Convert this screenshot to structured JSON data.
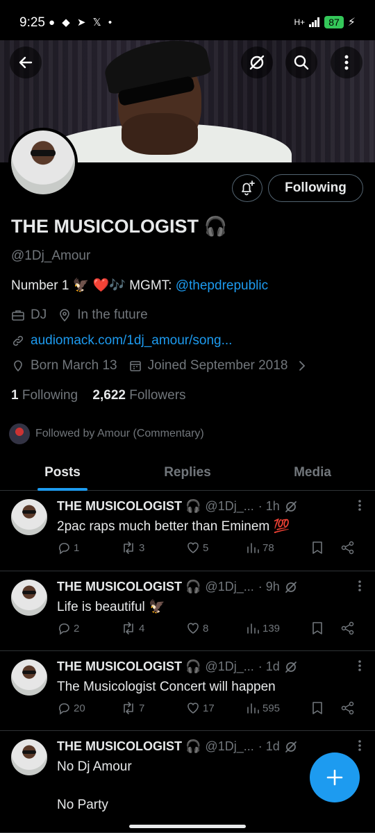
{
  "status_bar": {
    "time": "9:25",
    "notif_icons": "● ◆ ➤ 𝕏 •",
    "network": "H+",
    "battery": "87"
  },
  "header": {
    "back_icon": "back-arrow-icon",
    "icons": [
      "grok-icon",
      "search-icon",
      "more-vertical-icon"
    ]
  },
  "profile": {
    "name": "THE MUSICOLOGIST 🎧",
    "handle": "@1Dj_Amour",
    "bio_text": "Number 1 🦅 ❤️🎶 MGMT: ",
    "bio_link": "@thepdrepublic",
    "category": "DJ",
    "location": "In the future",
    "website": "audiomack.com/1dj_amour/song...",
    "born": "Born March 13",
    "joined": "Joined September 2018",
    "following_count": "1",
    "following_label": "Following",
    "followers_count": "2,622",
    "followers_label": "Followers",
    "followed_by": "Followed by Amour (Commentary)",
    "follow_button": "Following"
  },
  "tabs": [
    {
      "label": "Posts",
      "active": true
    },
    {
      "label": "Replies",
      "active": false
    },
    {
      "label": "Media",
      "active": false
    }
  ],
  "posts": [
    {
      "name": "THE MUSICOLOGIST 🎧",
      "handle": "@1Dj_...",
      "time": "· 1h",
      "text": "2pac raps much better than Eminem 💯",
      "replies": "1",
      "reposts": "3",
      "likes": "5",
      "views": "78"
    },
    {
      "name": "THE MUSICOLOGIST 🎧",
      "handle": "@1Dj_...",
      "time": "· 9h",
      "text": "Life is beautiful 🦅",
      "replies": "2",
      "reposts": "4",
      "likes": "8",
      "views": "139"
    },
    {
      "name": "THE MUSICOLOGIST 🎧",
      "handle": "@1Dj_...",
      "time": "· 1d",
      "text": "The Musicologist Concert will happen",
      "replies": "20",
      "reposts": "7",
      "likes": "17",
      "views": "595"
    },
    {
      "name": "THE MUSICOLOGIST 🎧",
      "handle": "@1Dj_...",
      "time": "· 1d",
      "text": "No Dj Amour",
      "text2": "No Party"
    }
  ],
  "colors": {
    "accent": "#1d9bf0",
    "background": "#000000",
    "muted": "#71767b",
    "text": "#e7e9ea",
    "border": "#2f3336"
  }
}
